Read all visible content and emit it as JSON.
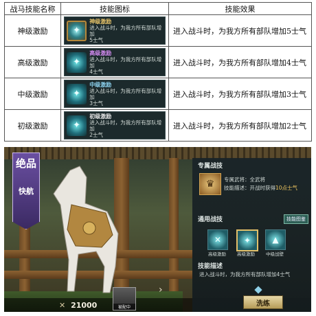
{
  "table": {
    "headers": [
      "战马技能名称",
      "技能图标",
      "技能效果"
    ],
    "rows": [
      {
        "name": "神级激励",
        "card_title": "神级激励",
        "card_line1": "进入战斗时，为我方所有部队增加",
        "card_line2": "5士气",
        "effect": "进入战斗时，为我方所有部队增加5士气",
        "title_color": "gold"
      },
      {
        "name": "高级激励",
        "card_title": "高级激励",
        "card_line1": "进入战斗时，为我方所有部队增加",
        "card_line2": "4士气",
        "effect": "进入战斗时，为我方所有部队增加4士气",
        "title_color": "purple"
      },
      {
        "name": "中级激励",
        "card_title": "中级激励",
        "card_line1": "进入战斗时，为我方所有部队增加",
        "card_line2": "3士气",
        "effect": "进入战斗时，为我方所有部队增加3士气",
        "title_color": "blue"
      },
      {
        "name": "初级激励",
        "card_title": "初级激励",
        "card_line1": "进入战斗时，为我方所有部队增加",
        "card_line2": "2士气",
        "effect": "进入战斗时，为我方所有部队增加2士气",
        "title_color": "white"
      }
    ]
  },
  "game": {
    "badge_top": "绝品",
    "badge_bottom": "快航",
    "coins_x": "✕",
    "coins": "21000",
    "avatar_label": "被配中",
    "panel": {
      "exclusive_heading": "专属战技",
      "exclusive_general_label": "专属武将：",
      "exclusive_general": "全武将",
      "exclusive_desc_label": "技能描述：",
      "exclusive_desc": "开战时获得",
      "exclusive_desc_value": "10点士气",
      "common_heading": "通用战技",
      "preview_button": "技能图鉴",
      "skills": [
        "高级激励",
        "高级激励",
        "中级战壁"
      ],
      "desc_heading": "技能描述",
      "desc_line1": "进入战斗时，为我方所有部队增加4士气",
      "train_button": "洗练"
    }
  },
  "colors": {
    "gold": "#e8c46a",
    "purple": "#d58cf3",
    "blue": "#8fd5f2",
    "white": "#e8e8e8"
  }
}
